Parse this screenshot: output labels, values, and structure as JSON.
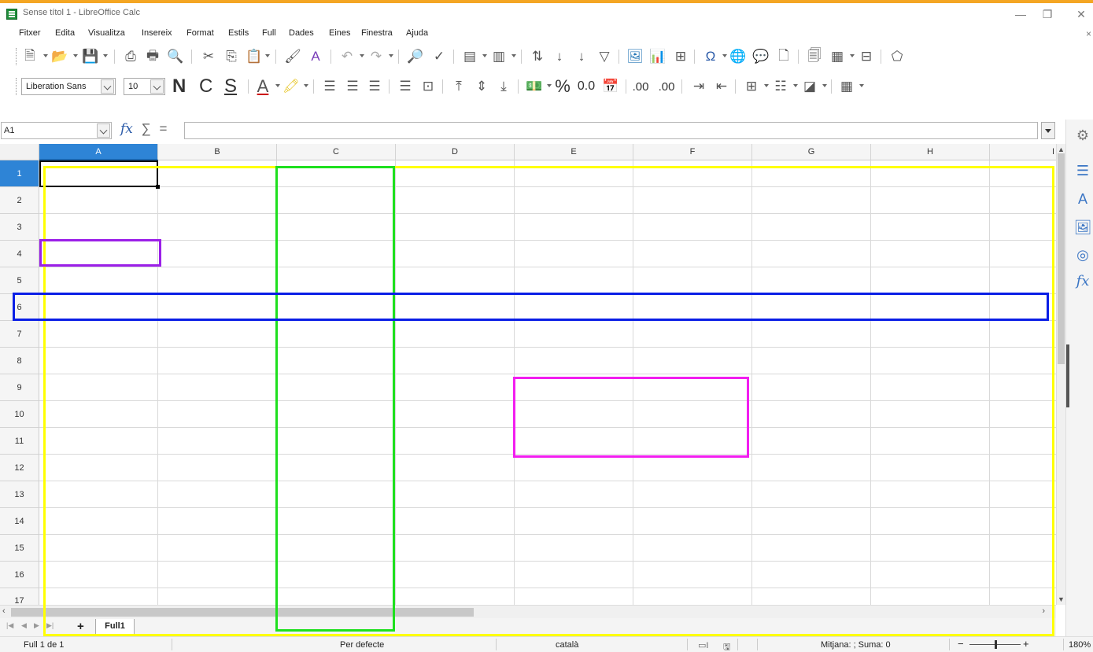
{
  "window": {
    "title": "Sense títol 1 - LibreOffice Calc",
    "controls": [
      "—",
      "❐",
      "✕"
    ]
  },
  "menu": {
    "items": [
      "Fitxer",
      "Edita",
      "Visualitza",
      "Insereix",
      "Format",
      "Estils",
      "Full",
      "Dades",
      "Eines",
      "Finestra",
      "Ajuda"
    ],
    "close_glyph": "×"
  },
  "formatting": {
    "font_name": "Liberation Sans",
    "font_size": "10",
    "bold_label": "N",
    "italic_label": "C",
    "underline_label": "S",
    "percent_label": "%",
    "decimal_label": "0.0",
    "add_decimal_label": ".00",
    "delete_decimal_label": ".00"
  },
  "formula_bar": {
    "name_box": "A1",
    "fx_label": "fx",
    "sum_label": "∑",
    "equal_label": "=",
    "formula": ""
  },
  "sheet": {
    "columns": [
      "A",
      "B",
      "C",
      "D",
      "E",
      "F",
      "G",
      "H",
      "I"
    ],
    "rows": [
      "1",
      "2",
      "3",
      "4",
      "5",
      "6",
      "7",
      "8",
      "9",
      "10",
      "11",
      "12",
      "13",
      "14",
      "15",
      "16",
      "17"
    ],
    "selected_cell": "A1",
    "tab_name": "Full1",
    "add_sheet_label": "+"
  },
  "status": {
    "sheet_position": "Full 1 de 1",
    "page_style": "Per defecte",
    "language": "català",
    "selection_stats": "Mitjana: ; Suma: 0",
    "zoom": "180%",
    "zoom_minus": "−",
    "zoom_plus": "+"
  },
  "sidebar": {
    "icons": [
      "settings-icon",
      "properties-icon",
      "styles-icon",
      "gallery-icon",
      "navigator-icon",
      "functions-icon"
    ]
  },
  "colors": {
    "accent": "#2e84d6",
    "title_border": "#f4a623"
  },
  "highlights": [
    {
      "name": "highlight-yellow",
      "color": "#ffff00"
    },
    {
      "name": "highlight-green",
      "color": "#1ee01e"
    },
    {
      "name": "highlight-purple",
      "color": "#9b1fe8"
    },
    {
      "name": "highlight-blue",
      "color": "#0a1ee6"
    },
    {
      "name": "highlight-magenta",
      "color": "#f21ef0"
    }
  ]
}
